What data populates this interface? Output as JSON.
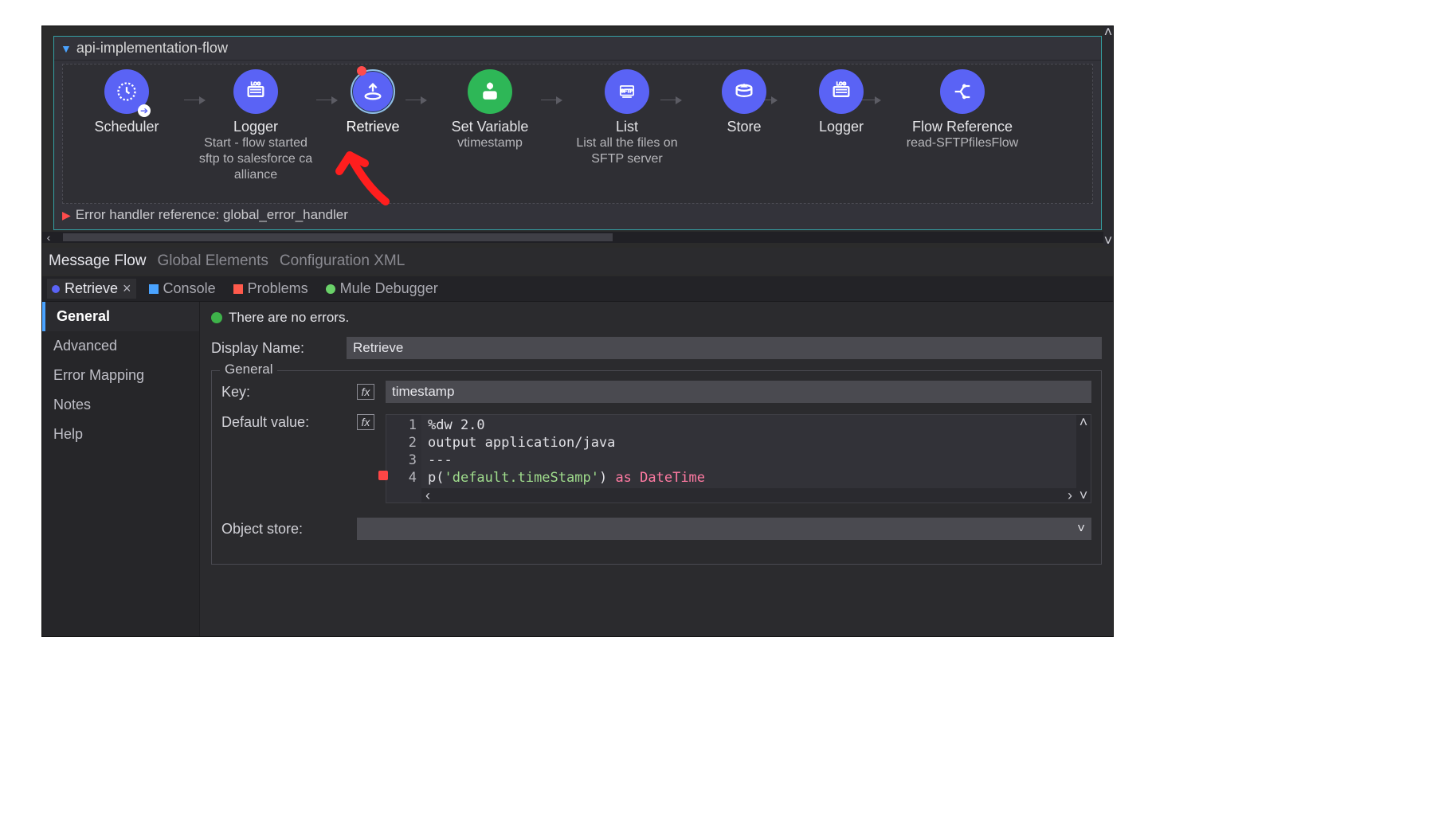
{
  "flow": {
    "title": "api-implementation-flow",
    "nodes": [
      {
        "label": "Scheduler",
        "sub": "",
        "icon": "scheduler"
      },
      {
        "label": "Logger",
        "sub": "Start - flow started sftp to salesforce ca alliance",
        "icon": "logger"
      },
      {
        "label": "Retrieve",
        "sub": "",
        "icon": "retrieve",
        "selected": true,
        "breakpoint": true
      },
      {
        "label": "Set Variable",
        "sub": "vtimestamp",
        "icon": "setvar",
        "green": true
      },
      {
        "label": "List",
        "sub": "List all the files on SFTP server",
        "icon": "list"
      },
      {
        "label": "Store",
        "sub": "",
        "icon": "store"
      },
      {
        "label": "Logger",
        "sub": "",
        "icon": "logger"
      },
      {
        "label": "Flow Reference",
        "sub": "read-SFTPfilesFlow",
        "icon": "flowref"
      }
    ],
    "error_handler": "Error handler reference: global_error_handler"
  },
  "editor_tabs": [
    "Message Flow",
    "Global Elements",
    "Configuration XML"
  ],
  "view_tabs": [
    "Retrieve",
    "Console",
    "Problems",
    "Mule Debugger"
  ],
  "sidenav": [
    "General",
    "Advanced",
    "Error Mapping",
    "Notes",
    "Help"
  ],
  "status": {
    "no_errors": "There are no errors."
  },
  "props": {
    "display_name_label": "Display Name:",
    "display_name_value": "Retrieve",
    "group_legend": "General",
    "key_label": "Key:",
    "key_value": "timestamp",
    "default_value_label": "Default value:",
    "object_store_label": "Object store:",
    "object_store_value": "",
    "fx": "fx",
    "code_lines": [
      "1",
      "2",
      "3",
      "4"
    ],
    "code": {
      "l1": "%dw 2.0",
      "l2": "output application/java",
      "l3": "---",
      "l4_a": "p(",
      "l4_str": "'default.timeStamp'",
      "l4_b": ") ",
      "l4_kw": "as DateTime"
    }
  }
}
